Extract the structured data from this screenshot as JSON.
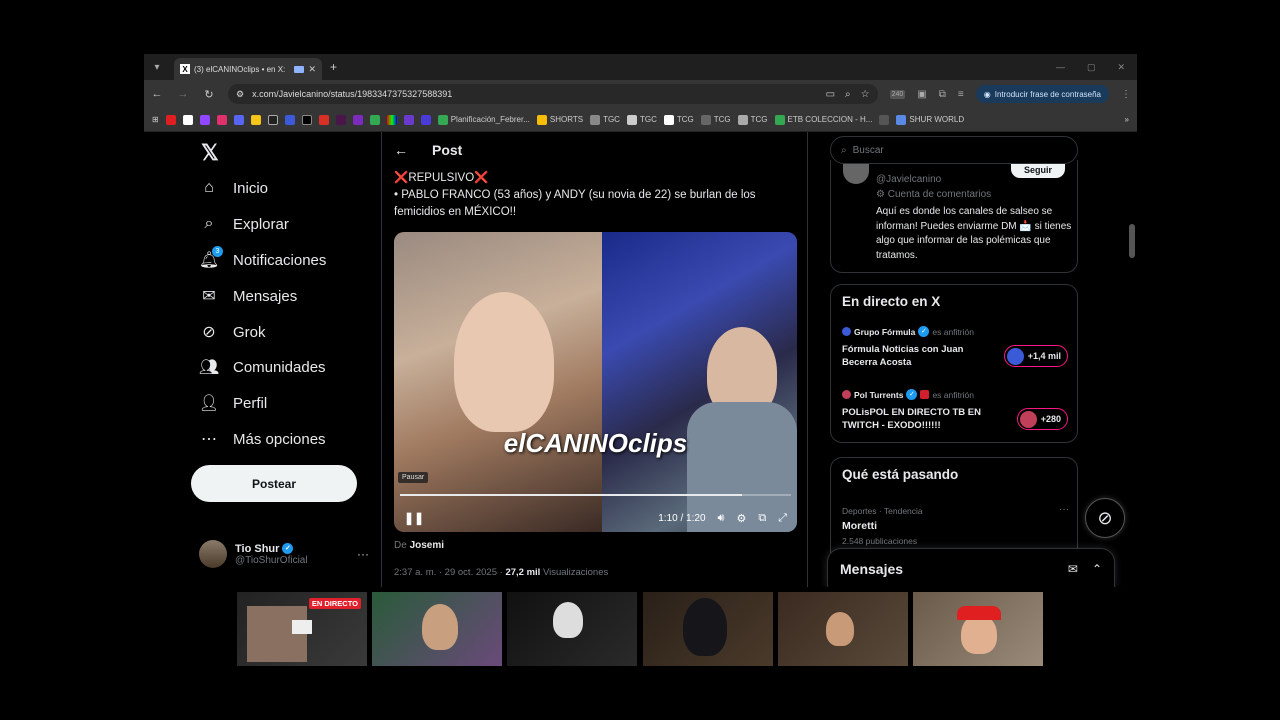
{
  "browser": {
    "tab_title": "(3) elCANINOclips • en X:",
    "tab_logo": "X",
    "url": "x.com/Javielcanino/status/1983347375327588391",
    "download_count": "240",
    "password_btn": "Introducir frase de contraseña",
    "bookmarks": [
      {
        "label": "Planificación_Febrer...",
        "color": "#34a853"
      },
      {
        "label": "SHORTS",
        "color": "#fbbc04"
      },
      {
        "label": "TGC",
        "color": "#888888"
      },
      {
        "label": "TGC",
        "color": "#cccccc"
      },
      {
        "label": "TCG",
        "color": "#ffffff"
      },
      {
        "label": "TCG",
        "color": "#666666"
      },
      {
        "label": "TCG",
        "color": "#aaaaaa"
      },
      {
        "label": "ETB COLECCION - H...",
        "color": "#34a853"
      },
      {
        "label": "SHUR WORLD",
        "color": "#5a8ae6"
      }
    ]
  },
  "nav": {
    "items": [
      {
        "label": "Inicio",
        "icon": "home-icon"
      },
      {
        "label": "Explorar",
        "icon": "search-icon"
      },
      {
        "label": "Notificaciones",
        "icon": "bell-icon"
      },
      {
        "label": "Mensajes",
        "icon": "mail-icon"
      },
      {
        "label": "Grok",
        "icon": "grok-icon"
      },
      {
        "label": "Comunidades",
        "icon": "people-icon"
      },
      {
        "label": "Perfil",
        "icon": "person-icon"
      },
      {
        "label": "Más opciones",
        "icon": "more-icon"
      }
    ],
    "notif_badge": "3",
    "post_button": "Postear",
    "profile": {
      "name": "Tio Shur",
      "handle": "@TioShurOficial"
    }
  },
  "post": {
    "header": "Post",
    "line1": "REPULSIVO",
    "line2": "• PABLO FRANCO (53 años) y ANDY (su novia de 22) se burlan de los femicidios en MÉXICO!!",
    "video": {
      "watermark": "elCANINOclips",
      "pause_tooltip": "Pausar",
      "time": "1:10 / 1:20",
      "progress": 0.875
    },
    "author_prefix": "De",
    "author": "Josemi",
    "timestamp": "2:37 a. m. · 29 oct. 2025 ·",
    "views_count": "27,2 mil",
    "views_label": "Visualizaciones"
  },
  "sidebar": {
    "search_placeholder": "Buscar",
    "profile_card": {
      "follow": "Seguir",
      "handle": "@Javielcanino",
      "sub": "Cuenta de comentarios",
      "bio": "Aquí es donde los canales de salseo se informan! Puedes enviarme DM 📩 si tienes algo que informar de las polémicas que tratamos."
    },
    "live": {
      "title": "En directo en X",
      "items": [
        {
          "host": "Grupo Fórmula",
          "role": "es anfitrión",
          "title": "Fórmula Noticias con Juan Becerra Acosta",
          "listeners": "+1,4 mil",
          "color": "#3a5ad8"
        },
        {
          "host": "Pol Turrents",
          "role": "es anfitrión",
          "title": "POLisPOL EN DIRECTO TB EN TWITCH - EXODO!!!!!!",
          "listeners": "+280",
          "color": "#c0405a"
        }
      ]
    },
    "trends": {
      "title": "Qué está pasando",
      "category": "Deportes · Tendencia",
      "name": "Moretti",
      "count": "2.548 publicaciones"
    },
    "messages": "Mensajes"
  },
  "stream": {
    "live_badge": "EN DIRECTO"
  }
}
